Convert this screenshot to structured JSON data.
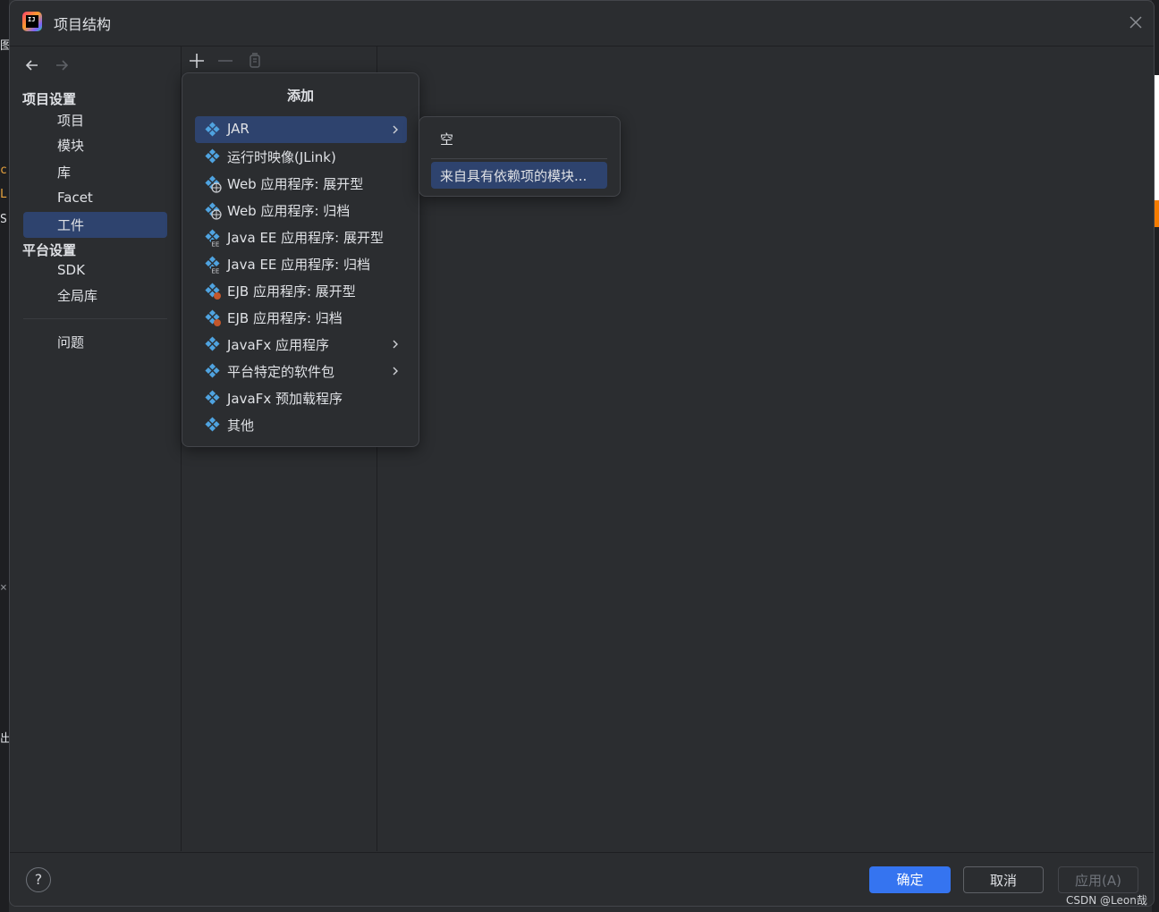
{
  "background": {
    "left_fragments": [
      "图",
      "c",
      "L",
      "S",
      "×",
      "出"
    ]
  },
  "window": {
    "title": "项目结构",
    "close_icon": "close-icon",
    "app_icon": "intellij-idea-icon"
  },
  "nav": {
    "back_icon": "arrow-left-icon",
    "forward_icon": "arrow-right-icon",
    "project_settings_header": "项目设置",
    "project_settings_items": [
      "项目",
      "模块",
      "库",
      "Facet",
      "工件"
    ],
    "selected_item": "工件",
    "platform_settings_header": "平台设置",
    "platform_settings_items": [
      "SDK",
      "全局库"
    ],
    "problems": "问题"
  },
  "toolbar": {
    "add_icon": "plus-icon",
    "remove_icon": "minus-icon",
    "copy_icon": "copy-icon"
  },
  "add_popup": {
    "title": "添加",
    "items": [
      {
        "label": "JAR",
        "icon": "artifact-icon",
        "submenu": true,
        "selected": true
      },
      {
        "label": "运行时映像(JLink)",
        "icon": "artifact-icon"
      },
      {
        "label": "Web 应用程序: 展开型",
        "icon": "web-artifact-icon"
      },
      {
        "label": "Web 应用程序: 归档",
        "icon": "web-artifact-icon"
      },
      {
        "label": "Java EE 应用程序: 展开型",
        "icon": "javaee-artifact-icon"
      },
      {
        "label": "Java EE 应用程序: 归档",
        "icon": "javaee-artifact-icon"
      },
      {
        "label": "EJB 应用程序: 展开型",
        "icon": "ejb-artifact-icon"
      },
      {
        "label": "EJB 应用程序: 归档",
        "icon": "ejb-artifact-icon"
      },
      {
        "label": "JavaFx 应用程序",
        "icon": "artifact-icon",
        "submenu": true
      },
      {
        "label": "平台特定的软件包",
        "icon": "artifact-icon",
        "submenu": true
      },
      {
        "label": "JavaFx 预加载程序",
        "icon": "artifact-icon"
      },
      {
        "label": "其他",
        "icon": "artifact-icon"
      }
    ]
  },
  "jar_submenu": {
    "items": [
      "空",
      "来自具有依赖项的模块..."
    ],
    "selected": "来自具有依赖项的模块..."
  },
  "footer": {
    "help": "?",
    "ok": "确定",
    "cancel": "取消",
    "apply": "应用(A)",
    "watermark": "CSDN @Leon哉"
  },
  "colors": {
    "accent": "#3574f0",
    "selection": "#2e436e",
    "background": "#2b2d30",
    "icon_blue": "#4fa3e0"
  }
}
